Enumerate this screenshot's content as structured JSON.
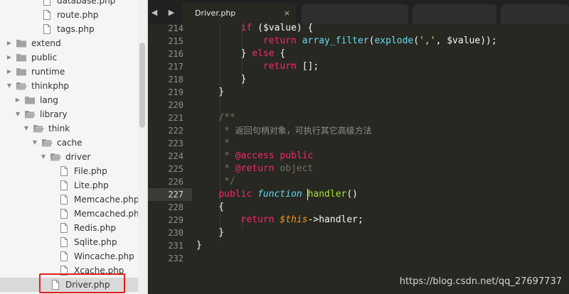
{
  "sidebar": {
    "items": [
      {
        "label": "database.php",
        "level": 3,
        "kind": "file",
        "state": ""
      },
      {
        "label": "route.php",
        "level": 3,
        "kind": "file",
        "state": ""
      },
      {
        "label": "tags.php",
        "level": 3,
        "kind": "file",
        "state": ""
      },
      {
        "label": "extend",
        "level": 0,
        "kind": "folder",
        "state": "collapsed"
      },
      {
        "label": "public",
        "level": 0,
        "kind": "folder",
        "state": "collapsed"
      },
      {
        "label": "runtime",
        "level": 0,
        "kind": "folder",
        "state": "collapsed"
      },
      {
        "label": "thinkphp",
        "level": 0,
        "kind": "folder",
        "state": "expanded"
      },
      {
        "label": "lang",
        "level": 1,
        "kind": "folder",
        "state": "collapsed"
      },
      {
        "label": "library",
        "level": 1,
        "kind": "folder",
        "state": "expanded"
      },
      {
        "label": "think",
        "level": 2,
        "kind": "folder",
        "state": "expanded"
      },
      {
        "label": "cache",
        "level": 3,
        "kind": "folder",
        "state": "expanded"
      },
      {
        "label": "driver",
        "level": 4,
        "kind": "folder",
        "state": "expanded"
      },
      {
        "label": "File.php",
        "level": 5,
        "kind": "file",
        "state": ""
      },
      {
        "label": "Lite.php",
        "level": 5,
        "kind": "file",
        "state": ""
      },
      {
        "label": "Memcache.php",
        "level": 5,
        "kind": "file",
        "state": ""
      },
      {
        "label": "Memcached.php",
        "level": 5,
        "kind": "file",
        "state": ""
      },
      {
        "label": "Redis.php",
        "level": 5,
        "kind": "file",
        "state": ""
      },
      {
        "label": "Sqlite.php",
        "level": 5,
        "kind": "file",
        "state": ""
      },
      {
        "label": "Wincache.php",
        "level": 5,
        "kind": "file",
        "state": ""
      },
      {
        "label": "Xcache.php",
        "level": 5,
        "kind": "file",
        "state": ""
      },
      {
        "label": "Driver.php",
        "level": 4,
        "kind": "file",
        "state": "selected"
      }
    ]
  },
  "tabbar": {
    "nav_arrows": "◀ ▶",
    "active_tab": {
      "title": "Driver.php",
      "close": "×"
    }
  },
  "editor": {
    "current_line": "227",
    "line_numbers": [
      "214",
      "215",
      "216",
      "217",
      "218",
      "219",
      "220",
      "221",
      "222",
      "223",
      "224",
      "225",
      "226",
      "227",
      "228",
      "229",
      "230",
      "231",
      "232"
    ],
    "lines": [
      [
        {
          "t": "        ",
          "c": ""
        },
        {
          "t": "if",
          "c": "kw"
        },
        {
          "t": " (",
          "c": ""
        },
        {
          "t": "$value",
          "c": "var"
        },
        {
          "t": ") {",
          "c": ""
        }
      ],
      [
        {
          "t": "            ",
          "c": ""
        },
        {
          "t": "return",
          "c": "kw"
        },
        {
          "t": " ",
          "c": ""
        },
        {
          "t": "array_filter",
          "c": "fn"
        },
        {
          "t": "(",
          "c": ""
        },
        {
          "t": "explode",
          "c": "fn"
        },
        {
          "t": "(",
          "c": ""
        },
        {
          "t": "','",
          "c": "str"
        },
        {
          "t": ", ",
          "c": ""
        },
        {
          "t": "$value",
          "c": "var"
        },
        {
          "t": "));",
          "c": ""
        }
      ],
      [
        {
          "t": "        ",
          "c": ""
        },
        {
          "t": "} ",
          "c": ""
        },
        {
          "t": "else",
          "c": "kw"
        },
        {
          "t": " {",
          "c": ""
        }
      ],
      [
        {
          "t": "            ",
          "c": ""
        },
        {
          "t": "return",
          "c": "kw"
        },
        {
          "t": " [];",
          "c": ""
        }
      ],
      [
        {
          "t": "        }",
          "c": ""
        }
      ],
      [
        {
          "t": "    }",
          "c": ""
        }
      ],
      [
        {
          "t": "",
          "c": ""
        }
      ],
      [
        {
          "t": "    ",
          "c": ""
        },
        {
          "t": "/**",
          "c": "cm"
        }
      ],
      [
        {
          "t": "     ",
          "c": ""
        },
        {
          "t": "* ",
          "c": "cm"
        },
        {
          "t": "返回句柄对象，可执行其它高级方法",
          "c": "cmz"
        }
      ],
      [
        {
          "t": "     ",
          "c": ""
        },
        {
          "t": "*",
          "c": "cm"
        }
      ],
      [
        {
          "t": "     ",
          "c": ""
        },
        {
          "t": "* ",
          "c": "cm"
        },
        {
          "t": "@access",
          "c": "kw"
        },
        {
          "t": " ",
          "c": "cm"
        },
        {
          "t": "public",
          "c": "kw"
        }
      ],
      [
        {
          "t": "     ",
          "c": ""
        },
        {
          "t": "* ",
          "c": "cm"
        },
        {
          "t": "@return",
          "c": "kw"
        },
        {
          "t": " object",
          "c": "cm"
        }
      ],
      [
        {
          "t": "     ",
          "c": ""
        },
        {
          "t": "*/",
          "c": "cm"
        }
      ],
      [
        {
          "t": "    ",
          "c": ""
        },
        {
          "t": "public",
          "c": "kw"
        },
        {
          "t": " ",
          "c": ""
        },
        {
          "t": "function",
          "c": "ty"
        },
        {
          "t": " ",
          "c": ""
        },
        {
          "t": "handler",
          "c": "fnm"
        },
        {
          "t": "()",
          "c": ""
        }
      ],
      [
        {
          "t": "    {",
          "c": ""
        }
      ],
      [
        {
          "t": "        ",
          "c": ""
        },
        {
          "t": "return",
          "c": "kw"
        },
        {
          "t": " ",
          "c": ""
        },
        {
          "t": "$this",
          "c": "th"
        },
        {
          "t": "->",
          "c": ""
        },
        {
          "t": "handler;",
          "c": ""
        }
      ],
      [
        {
          "t": "    }",
          "c": ""
        }
      ],
      [
        {
          "t": "}",
          "c": ""
        }
      ],
      [
        {
          "t": "",
          "c": ""
        }
      ]
    ]
  },
  "watermark": "https://blog.csdn.net/qq_27697737",
  "colors": {
    "background": "#272822",
    "keyword": "#f92672",
    "function": "#66d9ef",
    "function_name": "#a6e22e",
    "string": "#e6db74",
    "comment": "#75715e",
    "highlight_box": "#e02020"
  }
}
